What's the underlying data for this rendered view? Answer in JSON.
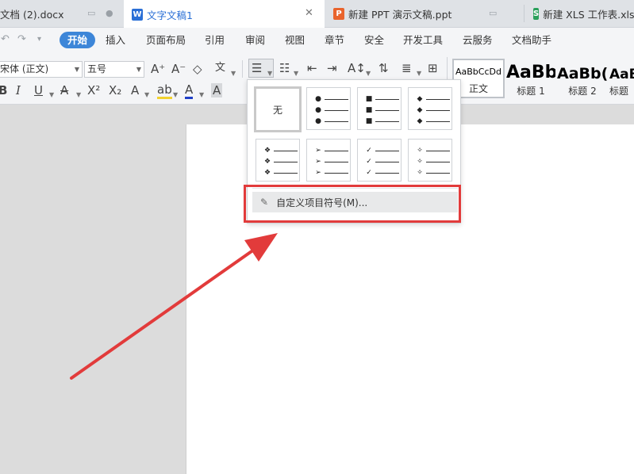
{
  "tabs": [
    {
      "label": "文档 (2).docx",
      "type": "doc",
      "icon": "",
      "active": false
    },
    {
      "label": "文字文稿1",
      "type": "doc",
      "icon": "W",
      "active": true
    },
    {
      "label": "新建 PPT 演示文稿.ppt",
      "type": "ppt",
      "icon": "P",
      "active": false
    },
    {
      "label": "新建 XLS 工作表.xls",
      "type": "xls",
      "icon": "S",
      "active": false
    }
  ],
  "tab_controls": {
    "close": "✕"
  },
  "menu": {
    "items": [
      "开始",
      "插入",
      "页面布局",
      "引用",
      "审阅",
      "视图",
      "章节",
      "安全",
      "开发工具",
      "云服务",
      "文档助手"
    ],
    "active_index": 0
  },
  "toolbar": {
    "font_family": "宋体 (正文)",
    "font_size": "五号",
    "styles": [
      {
        "sample": "AaBbCcDd",
        "name": "正文"
      },
      {
        "sample": "AaBb",
        "name": "标题 1"
      },
      {
        "sample": "AaBb(",
        "name": "标题 2"
      },
      {
        "sample": "AaB",
        "name": "标题"
      }
    ]
  },
  "bullet_menu": {
    "none_label": "无",
    "tiles": [
      {
        "symbol": "●"
      },
      {
        "symbol": "■"
      },
      {
        "symbol": "◆"
      },
      {
        "symbol": "❖"
      },
      {
        "symbol": "➢"
      },
      {
        "symbol": "✓"
      },
      {
        "symbol": "✧"
      }
    ],
    "custom_label": "自定义项目符号(M)..."
  },
  "colors": {
    "accent": "#3d86d8",
    "annotation_red": "#e23b3b",
    "doc_icon": "#2a6fd6",
    "ppt_icon": "#e9642d",
    "xls_icon": "#2aa05a"
  }
}
